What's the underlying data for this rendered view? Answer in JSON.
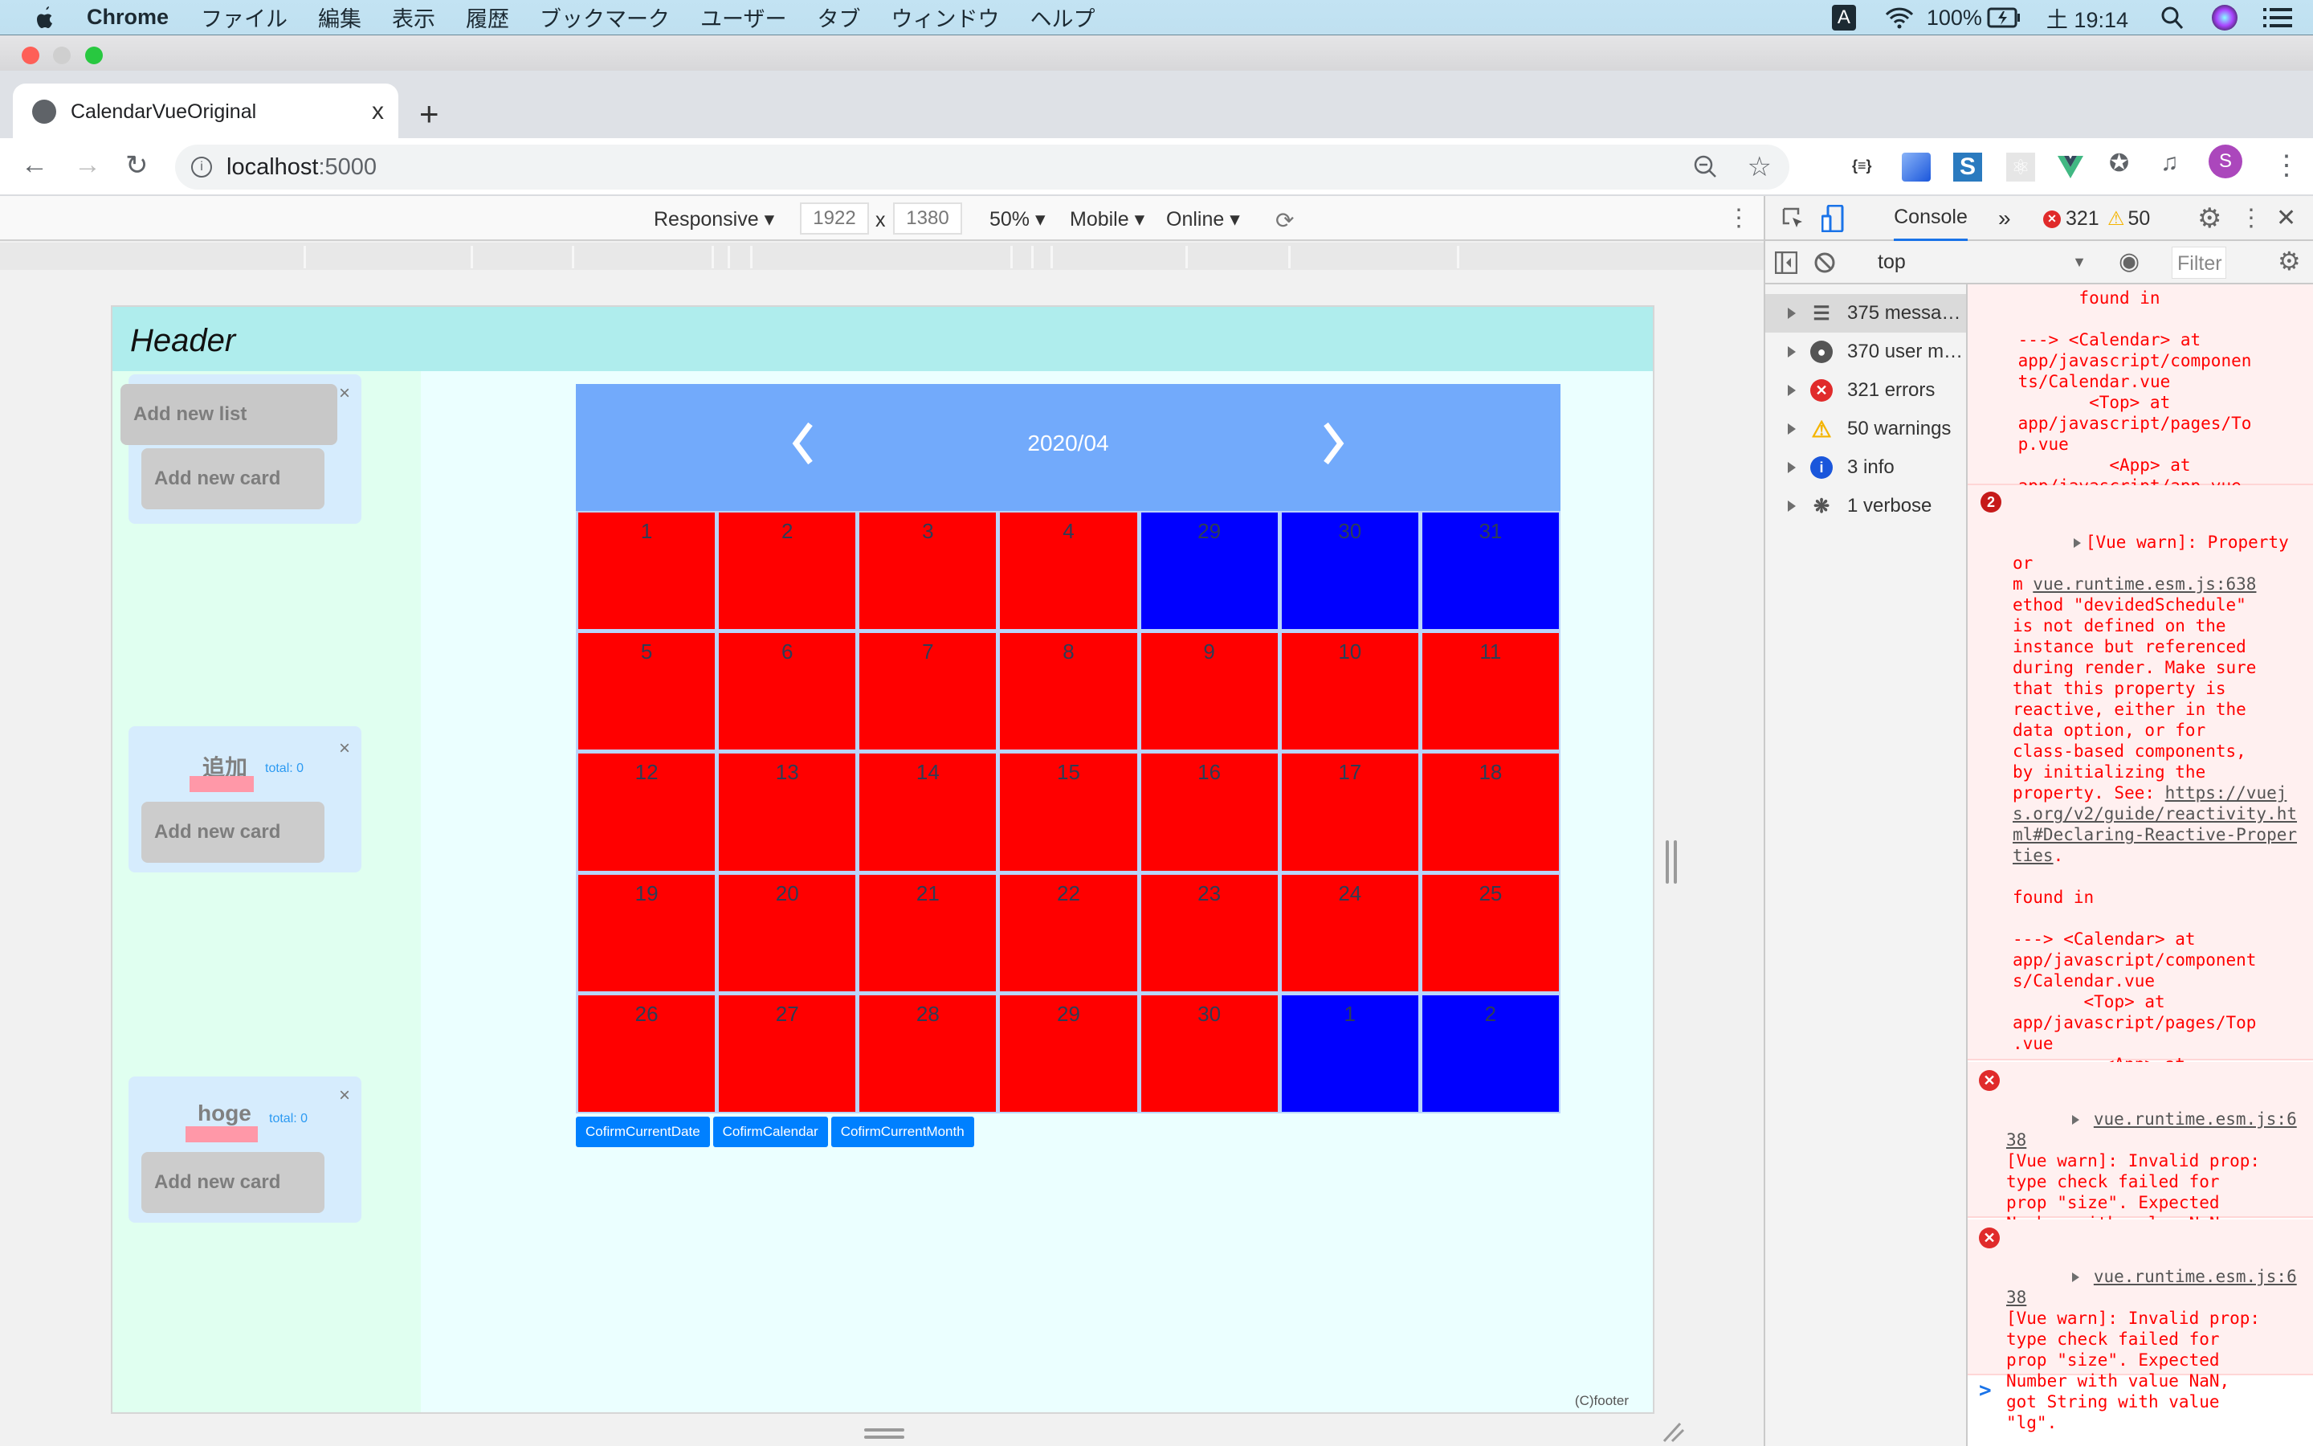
{
  "menubar": {
    "app_name": "Chrome",
    "items": [
      "ファイル",
      "編集",
      "表示",
      "履歴",
      "ブックマーク",
      "ユーザー",
      "タブ",
      "ウィンドウ",
      "ヘルプ"
    ],
    "input_method": "A",
    "battery": "100%",
    "clock": "土 19:14"
  },
  "browser": {
    "tab_title": "CalendarVueOriginal",
    "new_tab": "+",
    "tab_close": "x",
    "url_host": "localhost",
    "url_port": ":5000",
    "profile_initial": "S"
  },
  "device_toolbar": {
    "device": "Responsive",
    "width": "1922",
    "times": "x",
    "height": "1380",
    "zoom": "50%",
    "throttle_type": "Mobile",
    "network": "Online"
  },
  "app": {
    "header_title": "Header",
    "footer": "(C)footer",
    "add_list_label": "Add new list",
    "lists": [
      {
        "name": "",
        "total": "",
        "add_card_label": "Add new card",
        "close": "×"
      },
      {
        "name": "追加",
        "total": "total: 0",
        "add_card_label": "Add new card",
        "close": "×"
      },
      {
        "name": "hoge",
        "total": "total: 0",
        "add_card_label": "Add new card",
        "close": "×"
      }
    ],
    "calendar": {
      "month_label": "2020/04",
      "colors": {
        "current_month": "#ff0000",
        "other_month": "#0000ff",
        "header": "#72aafb"
      },
      "weeks": [
        [
          {
            "d": "1",
            "cur": true
          },
          {
            "d": "2",
            "cur": true
          },
          {
            "d": "3",
            "cur": true
          },
          {
            "d": "4",
            "cur": true
          },
          {
            "d": "29",
            "cur": false
          },
          {
            "d": "30",
            "cur": false
          },
          {
            "d": "31",
            "cur": false
          }
        ],
        [
          {
            "d": "5",
            "cur": true
          },
          {
            "d": "6",
            "cur": true
          },
          {
            "d": "7",
            "cur": true
          },
          {
            "d": "8",
            "cur": true
          },
          {
            "d": "9",
            "cur": true
          },
          {
            "d": "10",
            "cur": true
          },
          {
            "d": "11",
            "cur": true
          }
        ],
        [
          {
            "d": "12",
            "cur": true
          },
          {
            "d": "13",
            "cur": true
          },
          {
            "d": "14",
            "cur": true
          },
          {
            "d": "15",
            "cur": true
          },
          {
            "d": "16",
            "cur": true
          },
          {
            "d": "17",
            "cur": true
          },
          {
            "d": "18",
            "cur": true
          }
        ],
        [
          {
            "d": "19",
            "cur": true
          },
          {
            "d": "20",
            "cur": true
          },
          {
            "d": "21",
            "cur": true
          },
          {
            "d": "22",
            "cur": true
          },
          {
            "d": "23",
            "cur": true
          },
          {
            "d": "24",
            "cur": true
          },
          {
            "d": "25",
            "cur": true
          }
        ],
        [
          {
            "d": "26",
            "cur": true
          },
          {
            "d": "27",
            "cur": true
          },
          {
            "d": "28",
            "cur": true
          },
          {
            "d": "29",
            "cur": true
          },
          {
            "d": "30",
            "cur": true
          },
          {
            "d": "1",
            "cur": false
          },
          {
            "d": "2",
            "cur": false
          }
        ]
      ],
      "buttons": [
        "CofirmCurrentDate",
        "CofirmCalendar",
        "CofirmCurrentMonth"
      ]
    }
  },
  "devtools": {
    "active_tab": "Console",
    "more_tabs": "»",
    "error_count": "321",
    "warning_count": "50",
    "context": "top",
    "filter_placeholder": "Filter",
    "sidebar": [
      {
        "label": "375 messa…",
        "icon": "list"
      },
      {
        "label": "370 user m…",
        "icon": "user"
      },
      {
        "label": "321 errors",
        "icon": "error"
      },
      {
        "label": "50 warnings",
        "icon": "warning"
      },
      {
        "label": "3 info",
        "icon": "info"
      },
      {
        "label": "1 verbose",
        "icon": "bug"
      }
    ],
    "messages": [
      {
        "text": "    found in\n\n    ---> <Calendar> at\n    app/javascript/componen\n    ts/Calendar.vue\n           <Top> at\n    app/javascript/pages/To\n    p.vue\n             <App> at\n    app/javascript/app.vue\n               <Root>"
      },
      {
        "repeat": "2",
        "head": "[Vue warn]: Property or\nm ",
        "source": "vue.runtime.esm.js:638",
        "body": "\nethod \"devidedSchedule\"\nis not defined on the\ninstance but referenced\nduring render. Make sure\nthat this property is\nreactive, either in the\ndata option, or for\nclass-based components,\nby initializing the\nproperty. See: ",
        "link": "https://vuejs.org/v2/guide/reactivity.html#Declaring-Reactive-Properties",
        "tail": ".\n\nfound in\n\n---> <Calendar> at\napp/javascript/component\ns/Calendar.vue\n       <Top> at\napp/javascript/pages/Top\n.vue\n         <App> at\napp/javascript/app.vue\n           <Root>"
      },
      {
        "source": "vue.runtime.esm.js:638",
        "body": "[Vue warn]: Invalid prop:\ntype check failed for\nprop \"size\". Expected\nNumber with value NaN,\ngot String with value\n\"lg\"."
      },
      {
        "source": "vue.runtime.esm.js:638",
        "body": "[Vue warn]: Invalid prop:\ntype check failed for\nprop \"size\". Expected\nNumber with value NaN,\ngot String with value\n\"lg\"."
      }
    ],
    "prompt": ">"
  }
}
